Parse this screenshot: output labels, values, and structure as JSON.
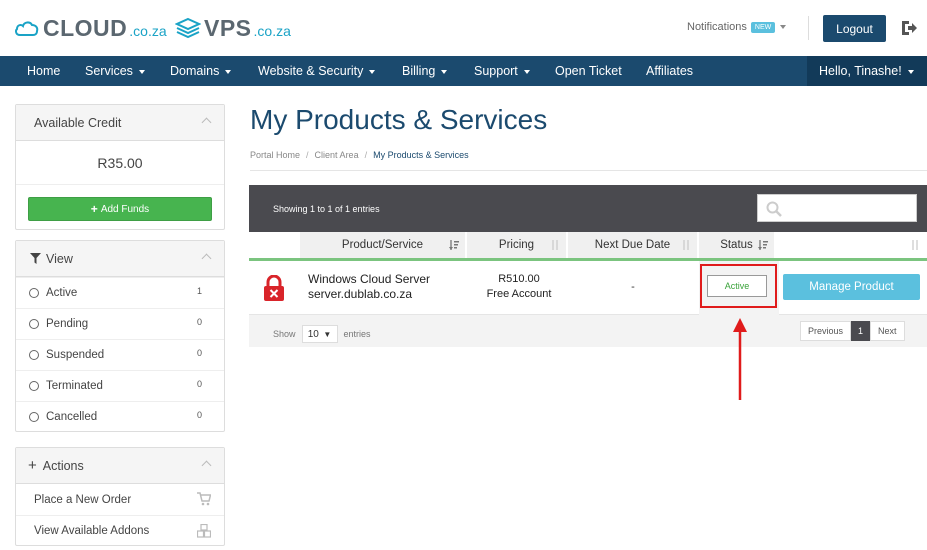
{
  "header": {
    "logo_cloud_word": "CLOUD",
    "logo_cloud_tld": ".co.za",
    "logo_vps_word": "VPS",
    "logo_vps_tld": ".co.za",
    "notifications_label": "Notifications",
    "new_badge": "NEW",
    "logout_label": "Logout"
  },
  "nav": {
    "items": [
      {
        "label": "Home"
      },
      {
        "label": "Services"
      },
      {
        "label": "Domains"
      },
      {
        "label": "Website & Security"
      },
      {
        "label": "Billing"
      },
      {
        "label": "Support"
      },
      {
        "label": "Open Ticket"
      },
      {
        "label": "Affiliates"
      }
    ],
    "user_label": "Hello, Tinashe!"
  },
  "sidebar": {
    "credit": {
      "title": "Available Credit",
      "amount": "R35.00",
      "add_funds_label": "Add Funds"
    },
    "view": {
      "title": "View",
      "items": [
        {
          "label": "Active",
          "count": "1"
        },
        {
          "label": "Pending",
          "count": "0"
        },
        {
          "label": "Suspended",
          "count": "0"
        },
        {
          "label": "Terminated",
          "count": "0"
        },
        {
          "label": "Cancelled",
          "count": "0"
        }
      ]
    },
    "actions": {
      "title": "Actions",
      "items": [
        {
          "label": "Place a New Order",
          "icon": "cart-icon"
        },
        {
          "label": "View Available Addons",
          "icon": "cubes-icon"
        }
      ]
    }
  },
  "main": {
    "title": "My Products & Services",
    "breadcrumb": [
      "Portal Home",
      "Client Area",
      "My Products & Services"
    ],
    "table": {
      "showing_text": "Showing 1 to 1 of 1 entries",
      "search_value": "",
      "columns": [
        "Product/Service",
        "Pricing",
        "Next Due Date",
        "Status",
        ""
      ],
      "rows": [
        {
          "product": "Windows Cloud Server",
          "domain": "server.dublab.co.za",
          "price": "R510.00",
          "billing": "Free Account",
          "next_due": "-",
          "status": "Active",
          "action_label": "Manage Product"
        }
      ],
      "show_label": "Show",
      "page_length": "10",
      "entries_label": "entries",
      "pager": {
        "prev": "Previous",
        "current": "1",
        "next": "Next"
      }
    }
  },
  "colors": {
    "brand_navy": "#1b4a6e",
    "accent_blue": "#5bc0de",
    "success_green": "#47b44f",
    "highlight_red": "#e01b1b"
  }
}
